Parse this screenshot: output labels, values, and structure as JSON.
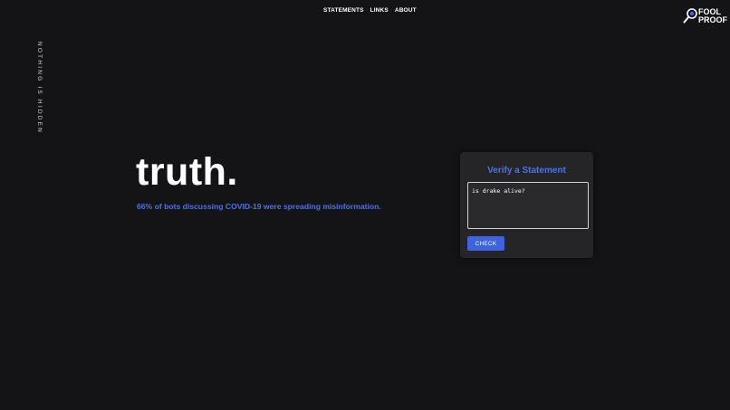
{
  "nav": {
    "items": [
      {
        "label": "STATEMENTS"
      },
      {
        "label": "LINKS"
      },
      {
        "label": "ABOUT"
      }
    ]
  },
  "logo": {
    "line1": "FOOL",
    "line2": "PROOF",
    "icon": "magnifier-icon"
  },
  "side": {
    "tagline": "NOTHING IS HIDDEN"
  },
  "hero": {
    "title": "truth.",
    "fact": "66% of bots discussing COVID-19 were spreading misinformation."
  },
  "verify": {
    "title": "Verify a Statement",
    "input_value": "is drake alive?",
    "button_label": "CHECK"
  },
  "colors": {
    "background": "#141416",
    "card": "#252527",
    "accent": "#4a73e8",
    "button": "#3f63e0"
  }
}
